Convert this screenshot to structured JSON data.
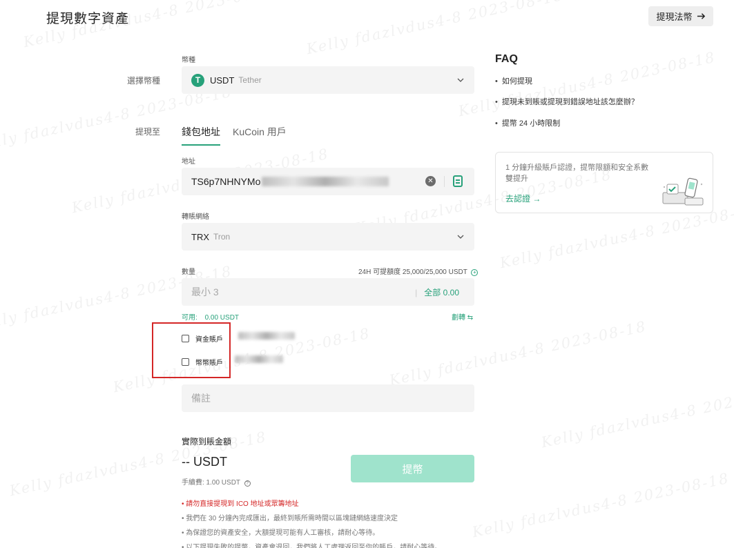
{
  "header": {
    "title": "提現數字資產",
    "fiat_button": "提現法幣"
  },
  "form": {
    "currency_small_label": "幣種",
    "currency_side_label": "選擇幣種",
    "currency": {
      "icon_letter": "T",
      "code": "USDT",
      "name": "Tether"
    },
    "to_side_label": "提現至",
    "tabs": [
      "錢包地址",
      "KuCoin 用戶"
    ],
    "address_label": "地址",
    "address_value": "TS6p7NHNYMo",
    "network_label": "轉賬網絡",
    "network": {
      "code": "TRX",
      "name": "Tron"
    },
    "amount_label": "數量",
    "limit_text": "24H 可提額度 25,000/25,000 USDT",
    "amount_placeholder": "最小 3",
    "all_label": "全部",
    "all_value": "0.00",
    "available_label": "可用:",
    "available_value": "0.00 USDT",
    "transfer_label": "劃轉",
    "accounts": [
      "資金賬戶",
      "幣幣賬戶"
    ],
    "memo_placeholder": "備註",
    "received_label": "實際到賬金額",
    "received_value": "-- USDT",
    "fee_label": "手續費: 1.00 USDT",
    "submit_label": "提幣"
  },
  "notes": [
    "• 請勿直接提現到 ICO 地址或眾籌地址",
    "• 我們在 30 分鐘內完成匯出，最終到賬所需時間以區塊鏈網絡速度決定",
    "• 為保證您的資產安全，大額提現可能有人工審核，請耐心等待。",
    "• 以下提現失敗的提幣，資產會退回，我們將人工處理返回至你的賬戶，請耐心等待。"
  ],
  "faq": {
    "title": "FAQ",
    "items": [
      "如何提現",
      "提現未到賬或提現到錯誤地址該怎麼辦？",
      "提幣 24 小時限制"
    ]
  },
  "kyc": {
    "text": "1 分鐘升級賬戶認證，提幣限額和安全系數雙提升",
    "link": "去認證"
  },
  "watermark": "Kelly fdazlvdus4-8 2023-08-18",
  "colors": {
    "accent": "#27a17a",
    "warning": "#d42626",
    "submit_disabled": "#9fe3cc"
  }
}
